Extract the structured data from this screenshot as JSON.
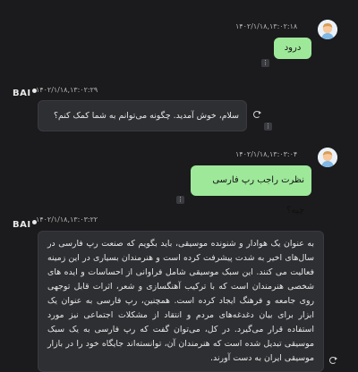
{
  "messages": [
    {
      "role": "user",
      "timestamp": "۱۴۰۲/۱/۱۸,۱۳:۰۲:۱۸",
      "text": "درود"
    },
    {
      "role": "assistant",
      "timestamp": "۱۴۰۲/۱/۱۸,۱۳:۰۲:۲۹",
      "text": "سلام، خوش آمدید. چگونه می‌توانم به شما کمک کنم؟"
    },
    {
      "role": "user",
      "timestamp": "۱۴۰۲/۱/۱۸,۱۳:۰۳:۰۴",
      "text": "نظرت راجب رپ فارسی چیه؟"
    },
    {
      "role": "assistant",
      "timestamp": "۱۴۰۲/۱/۱۸,۱۳:۰۳:۲۲",
      "text": "به عنوان یک هوادار و شنونده موسیقی، باید بگویم که صنعت رپ فارسی در سال‌های اخیر به شدت پیشرفت کرده است و هنرمندان بسیاری در این زمینه فعالیت می کنند. این سبک موسیقی شامل فراوانی از احساسات و ایده های شخصی هنرمندان است که با ترکیب آهنگسازی و شعر، اثرات قابل توجهی روی جامعه و فرهنگ ایجاد کرده است. همچنین، رپ فارسی به عنوان یک ابزار برای بیان دغدغه‌های مردم و انتقاد از مشکلات اجتماعی نیز مورد استفاده قرار می‌گیرد. در کل، می‌توان گفت که رپ فارسی به یک سبک موسیقی تبدیل شده است که هنرمندان آن، توانسته‌اند جایگاه خود را در بازار موسیقی ایران به دست آورند."
    }
  ],
  "assistant_name": "BAI",
  "icons": {
    "avatar": "user-avatar-icon",
    "menu": "more-options-icon",
    "regenerate": "refresh-icon"
  },
  "colors": {
    "background": "#1b1b1d",
    "user_bubble": "#9ee89a",
    "bot_bubble": "#2e2f33"
  }
}
